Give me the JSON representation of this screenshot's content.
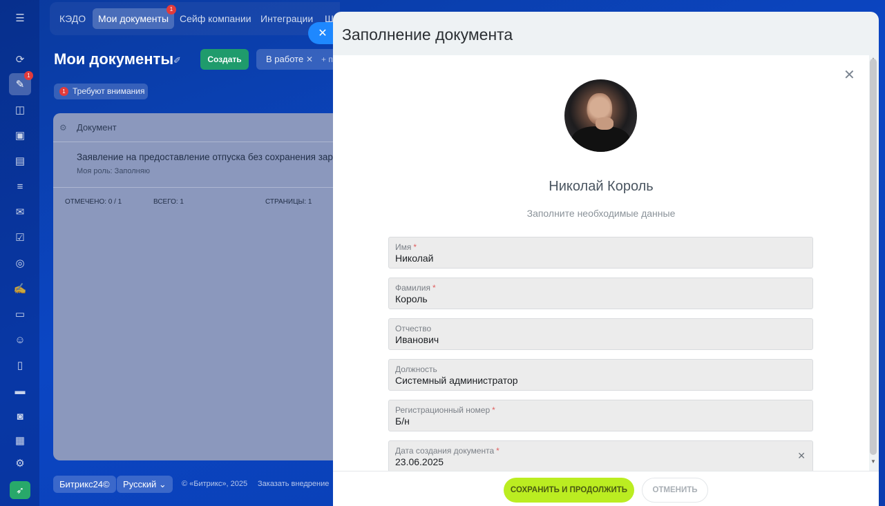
{
  "rail": {
    "badge": "1",
    "icons": [
      "menu-icon",
      "pulse-icon",
      "documents-icon",
      "chat-icon",
      "drive-icon",
      "tasks-icon",
      "filter-icon",
      "mail-icon",
      "check-icon",
      "goals-icon",
      "sign-icon",
      "card-icon",
      "team-icon",
      "file-icon",
      "storage-icon",
      "robot-icon",
      "calendar-icon",
      "settings-icon",
      "rocket-icon"
    ]
  },
  "topnav": {
    "tabs": [
      "КЭДО",
      "Мои документы",
      "Сейф компании",
      "Интеграции",
      "Ш"
    ],
    "badge": "1"
  },
  "header": {
    "title": "Мои документы",
    "create_label": "Создать",
    "filter_label": "В работе",
    "filter_remove": "✕",
    "filter_add": "+ п"
  },
  "attention": {
    "count": "1",
    "label": "Требуют внимания"
  },
  "grid": {
    "column": "Документ",
    "rows": [
      {
        "title": "Заявление на предоставление отпуска без сохранения зараб",
        "role": "Моя роль: Заполняю"
      }
    ],
    "footer": {
      "marked": "ОТМЕЧЕНО: 0 / 1",
      "total": "ВСЕГО: 1",
      "pages": "СТРАНИЦЫ:   1"
    }
  },
  "bottom": {
    "brand": "Битрикс24©",
    "language": "Русский",
    "copyright": "© «Битрикс», 2025",
    "order": "Заказать внедрение"
  },
  "slider": {
    "title": "Заполнение документа",
    "user_name": "Николай Король",
    "hint": "Заполните необходимые данные",
    "fields": [
      {
        "label": "Имя",
        "required": true,
        "value": "Николай"
      },
      {
        "label": "Фамилия",
        "required": true,
        "value": "Король"
      },
      {
        "label": "Отчество",
        "required": false,
        "value": "Иванович"
      },
      {
        "label": "Должность",
        "required": false,
        "value": "Системный администратор"
      },
      {
        "label": "Регистрационный номер",
        "required": true,
        "value": "Б/н"
      },
      {
        "label": "Дата создания документа",
        "required": true,
        "value": "23.06.2025"
      }
    ],
    "save_label": "Сохранить и продолжить",
    "cancel_label": "Отменить"
  },
  "colors": {
    "background": "#0b46c4",
    "primary_action": "#bbed21",
    "create_button": "#1f9b6c",
    "badge": "#e23b3b"
  }
}
